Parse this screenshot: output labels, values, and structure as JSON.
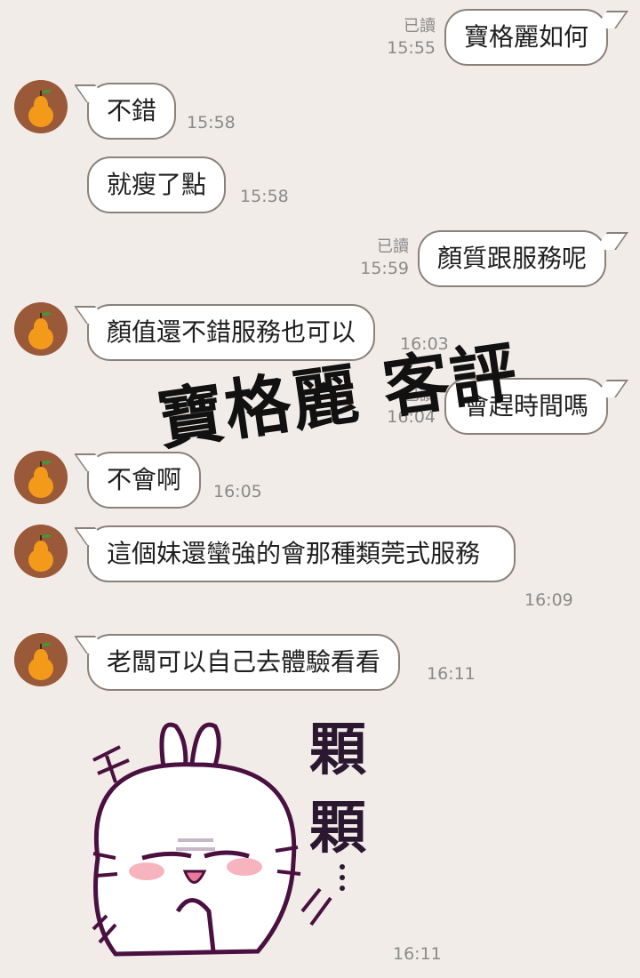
{
  "chat": {
    "messages": [
      {
        "sender": "me",
        "text": "寶格麗如何",
        "read_label": "已讀",
        "time": "15:55"
      },
      {
        "sender": "other",
        "text": "不錯",
        "time": "15:58"
      },
      {
        "sender": "other",
        "text": "就瘦了點",
        "time": "15:58"
      },
      {
        "sender": "me",
        "text": "顏質跟服務呢",
        "read_label": "已讀",
        "time": "15:59"
      },
      {
        "sender": "other",
        "text": "顏值還不錯服務也可以",
        "time": "16:03"
      },
      {
        "sender": "me",
        "text": "會趕時間嗎",
        "read_label": "已讀",
        "time": "16:04"
      },
      {
        "sender": "other",
        "text": "不會啊",
        "time": "16:05"
      },
      {
        "sender": "other",
        "text": "這個妹還蠻強的會那種類莞式服務",
        "time": "16:09"
      },
      {
        "sender": "other",
        "text": "老闆可以自己去體驗看看",
        "time": "16:11"
      },
      {
        "sender": "other",
        "sticker_text": "顆顆",
        "time": "16:11"
      }
    ]
  },
  "watermark": {
    "text": "寶格麗 客評"
  },
  "icons": {
    "avatar": "orange-fruit-icon",
    "sticker": "white-rabbit-sticker"
  },
  "colors": {
    "background": "#f1ece8",
    "bubble": "#ffffff",
    "bubble_border": "#8a817a",
    "time_text": "#8a8a8a",
    "avatar_bg": "#9a5a3a",
    "orange": "#f39a1a"
  }
}
